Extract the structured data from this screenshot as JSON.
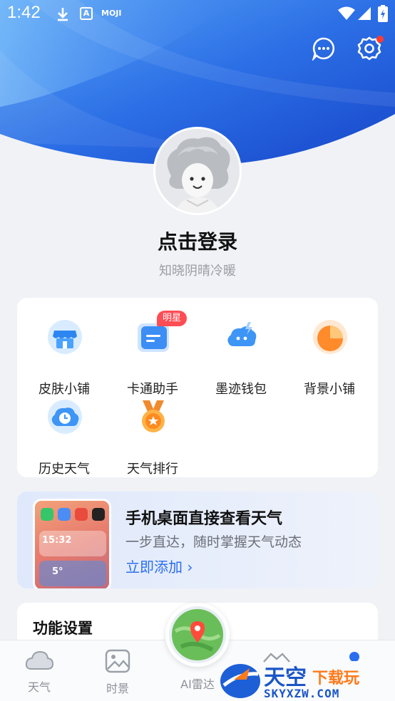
{
  "status_bar": {
    "time": "1:42",
    "icons": [
      "download-icon",
      "a-notification-icon",
      "moji-notification-icon",
      "wifi-icon",
      "signal-icon",
      "battery-charging-icon"
    ],
    "moji_label": "MOJI",
    "a_label": "A"
  },
  "header": {
    "message_icon": "chat-bubble-icon",
    "settings_icon": "gear-icon",
    "settings_badge": true,
    "accent_color": "#2a6ef0"
  },
  "profile": {
    "login_label": "点击登录",
    "tagline": "知晓阴晴冷暖"
  },
  "features": {
    "items": [
      {
        "label": "皮肤小铺",
        "icon": "shop-icon"
      },
      {
        "label": "卡通助手",
        "icon": "cartoon-assistant-icon",
        "badge": "明星"
      },
      {
        "label": "墨迹钱包",
        "icon": "wallet-icon"
      },
      {
        "label": "背景小铺",
        "icon": "background-shop-icon"
      },
      {
        "label": "历史天气",
        "icon": "history-weather-icon"
      },
      {
        "label": "天气排行",
        "icon": "weather-ranking-medal-icon"
      }
    ]
  },
  "promo": {
    "title": "手机桌面直接查看天气",
    "subtitle": "一步直达，随时掌握天气动态",
    "link": "立即添加 ›",
    "widget_time": "15:32",
    "widget_temp": "5°"
  },
  "settings": {
    "title": "功能设置"
  },
  "bottom_nav": {
    "items": [
      {
        "label": "天气",
        "icon": "cloud-icon"
      },
      {
        "label": "时景",
        "icon": "photo-icon"
      },
      {
        "label": "AI雷达",
        "icon": "radar-map-icon"
      },
      {
        "label": "",
        "icon": "mountain-icon"
      },
      {
        "label": "",
        "icon": "profile-icon"
      }
    ]
  },
  "watermark": {
    "brand": "天空",
    "brand_accent": "下载玩",
    "domain": "SKYXZW.COM"
  }
}
